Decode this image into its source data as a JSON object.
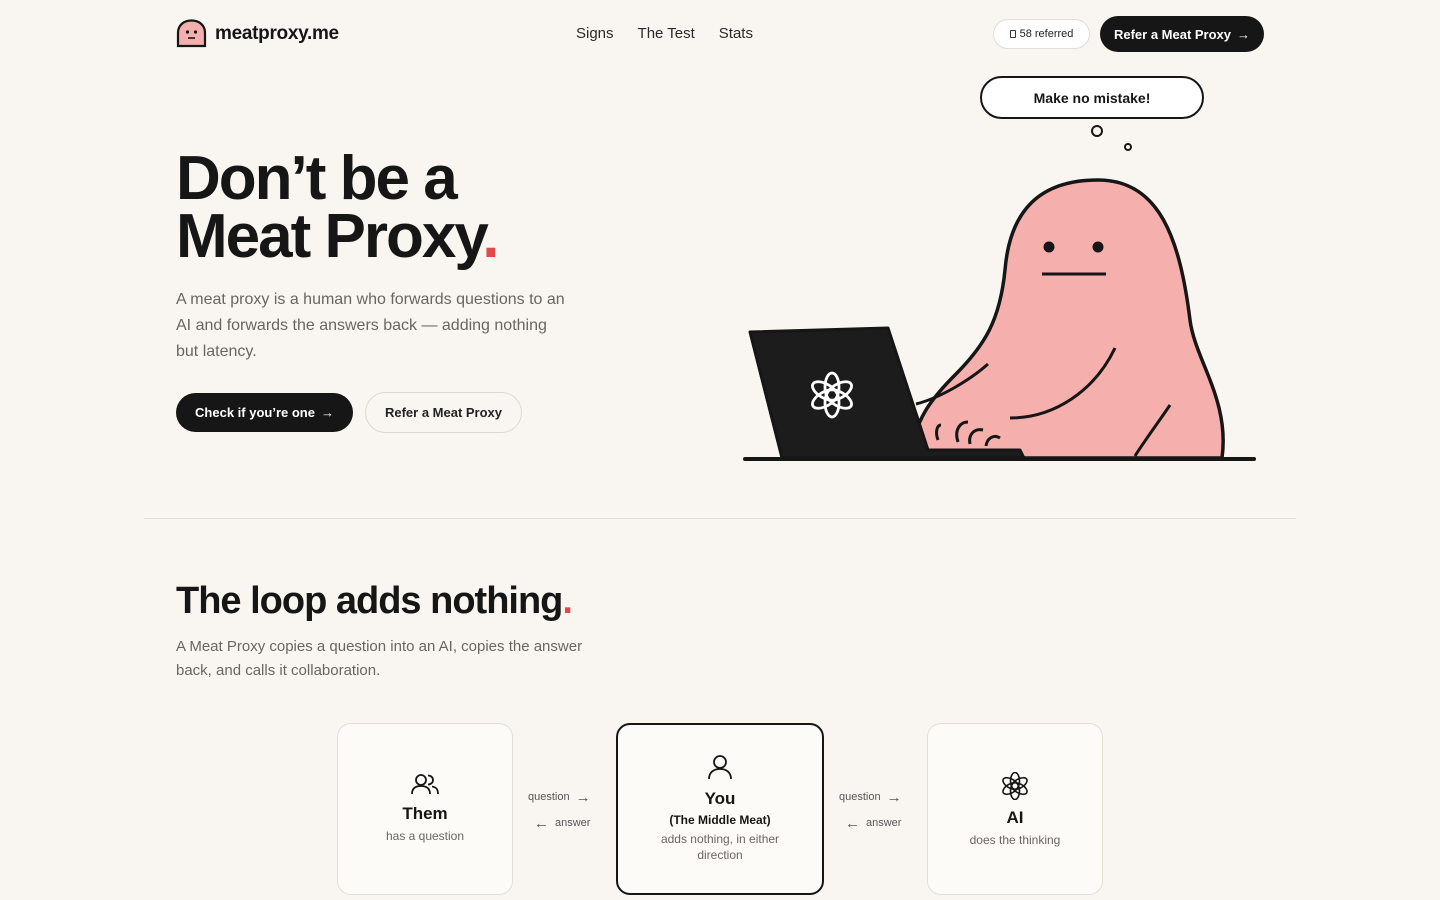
{
  "header": {
    "logo_text": "meatproxy.me",
    "nav": [
      "Signs",
      "The Test",
      "Stats"
    ],
    "referred_count": "58 referred",
    "cta_label": "Refer a Meat Proxy"
  },
  "hero": {
    "title_line1": "Don’t be a",
    "title_line2": "Meat Proxy",
    "title_dot": ".",
    "subtitle": "A meat proxy is a human who forwards questions to an AI and forwards the answers back — adding nothing but latency.",
    "primary_button": "Check if you’re one",
    "secondary_button": "Refer a Meat Proxy",
    "thought_bubble": "Make no mistake!"
  },
  "loop": {
    "title": "The loop adds nothing",
    "title_dot": ".",
    "subtitle": "A Meat Proxy copies a question into an AI, copies the answer back, and calls it collaboration.",
    "cards": [
      {
        "title": "Them",
        "desc": "has a question",
        "icon": "people-icon"
      },
      {
        "title": "You",
        "subtitle": "(The Middle Meat)",
        "desc": "adds nothing, in either direction",
        "icon": "person-icon"
      },
      {
        "title": "AI",
        "desc": "does the thinking",
        "icon": "openai-icon"
      }
    ],
    "arrow_question": "question",
    "arrow_answer": "answer"
  },
  "colors": {
    "background": "#f9f6f1",
    "blob": "#f5b0ad",
    "accent": "#e04a4a",
    "dark": "#161616"
  }
}
